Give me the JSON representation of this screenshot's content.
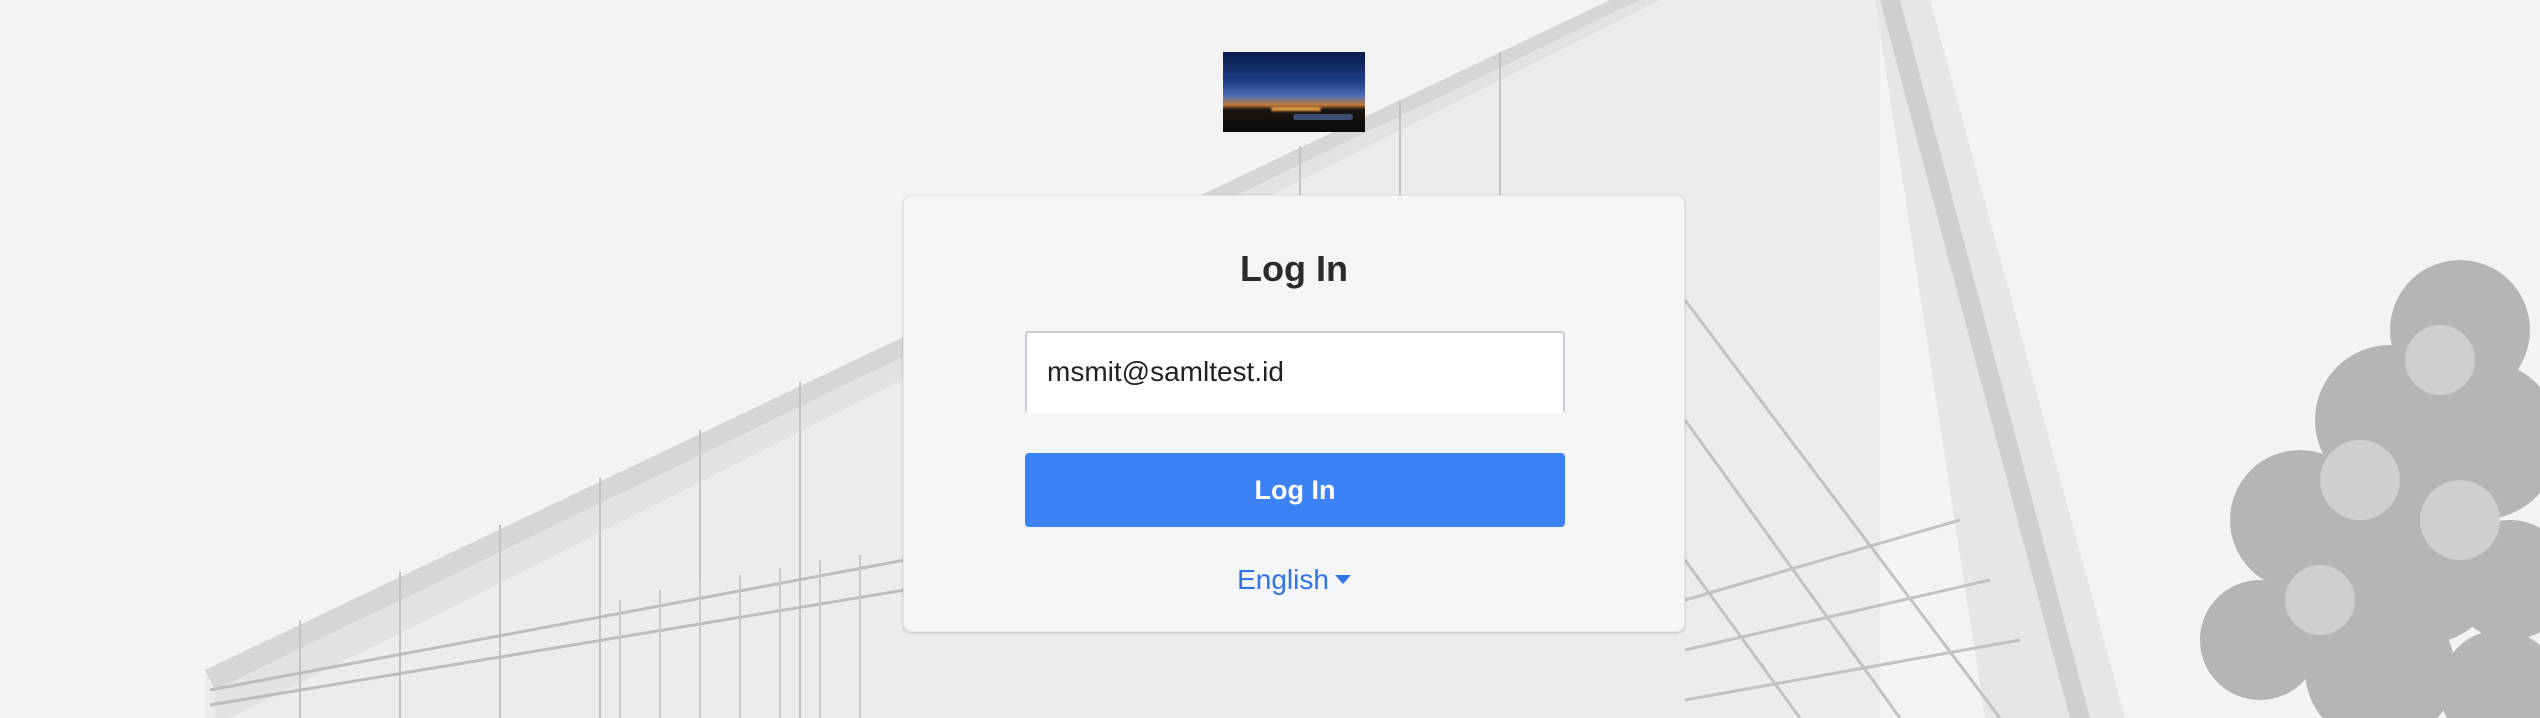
{
  "login": {
    "title": "Log In",
    "email_value": "msmit@samltest.id",
    "button_label": "Log In"
  },
  "language": {
    "selected": "English"
  },
  "colors": {
    "primary": "#3c81f5",
    "link": "#2f74e6",
    "card_bg": "#f4f5f7"
  },
  "icons": {
    "language_caret": "caret-down-icon"
  }
}
